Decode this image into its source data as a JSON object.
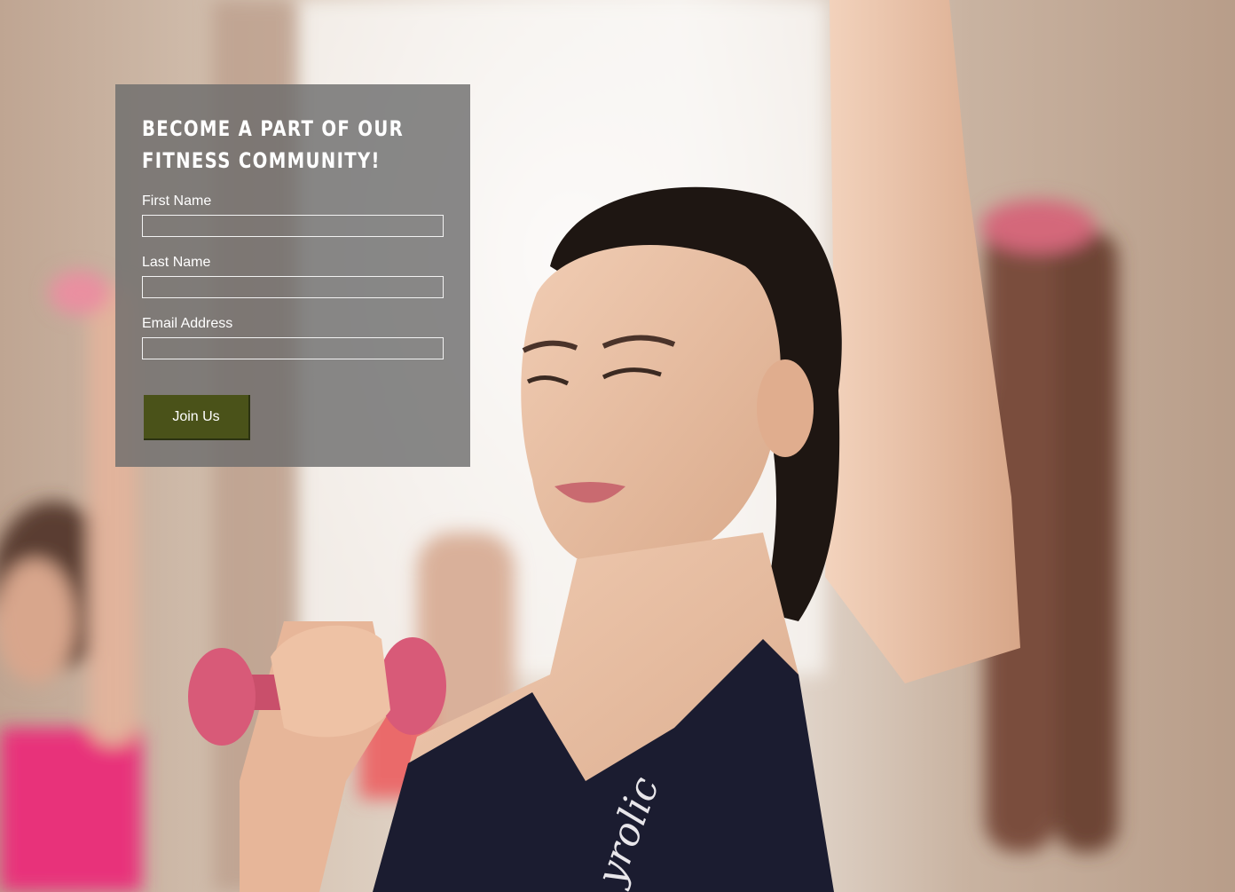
{
  "hero": {
    "image_alt": "Woman lifting pink dumbbells in a fitness class",
    "shirt_logo_text": "yrolic"
  },
  "signup": {
    "title_line1": "Become a part of our",
    "title_line2": "fitness community!",
    "fields": [
      {
        "label": "First Name",
        "value": "",
        "placeholder": ""
      },
      {
        "label": "Last Name",
        "value": "",
        "placeholder": ""
      },
      {
        "label": "Email Address",
        "value": "",
        "placeholder": ""
      }
    ],
    "submit_label": "Join Us"
  },
  "colors": {
    "card_overlay": "#6c6c6c",
    "button_bg": "#4a5219",
    "text": "#ffffff"
  }
}
